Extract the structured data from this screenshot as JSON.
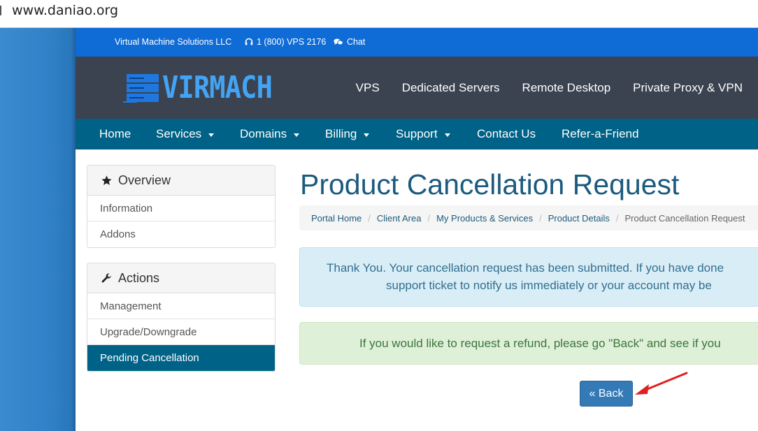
{
  "browser": {
    "url": "www.daniao.org"
  },
  "topbar": {
    "company": "Virtual Machine Solutions LLC",
    "phone": "1 (800) VPS 2176",
    "chat": "Chat"
  },
  "header": {
    "logo_text": "VIRMACH",
    "nav": [
      "VPS",
      "Dedicated Servers",
      "Remote Desktop",
      "Private Proxy & VPN"
    ]
  },
  "mainnav": {
    "home": "Home",
    "services": "Services",
    "domains": "Domains",
    "billing": "Billing",
    "support": "Support",
    "contact": "Contact Us",
    "refer": "Refer-a-Friend"
  },
  "sidebar": {
    "overview": {
      "title": "Overview",
      "items": [
        "Information",
        "Addons"
      ]
    },
    "actions": {
      "title": "Actions",
      "items": [
        "Management",
        "Upgrade/Downgrade",
        "Pending Cancellation"
      ]
    }
  },
  "main": {
    "title": "Product Cancellation Request",
    "breadcrumb": [
      "Portal Home",
      "Client Area",
      "My Products & Services",
      "Product Details",
      "Product Cancellation Request"
    ],
    "info_line1": "Thank You. Your cancellation request has been submitted. If you have done",
    "info_line2": "support ticket to notify us immediately or your account may be",
    "success_line": "If you would like to request a refund, please go \"Back\" and see if you",
    "back_label": "« Back"
  },
  "colors": {
    "topbar": "#0f6bd6",
    "header": "#3b4350",
    "mainnav": "#006287",
    "title": "#1c5b7e",
    "button": "#337ab7",
    "annotation_arrow": "#e02020"
  }
}
